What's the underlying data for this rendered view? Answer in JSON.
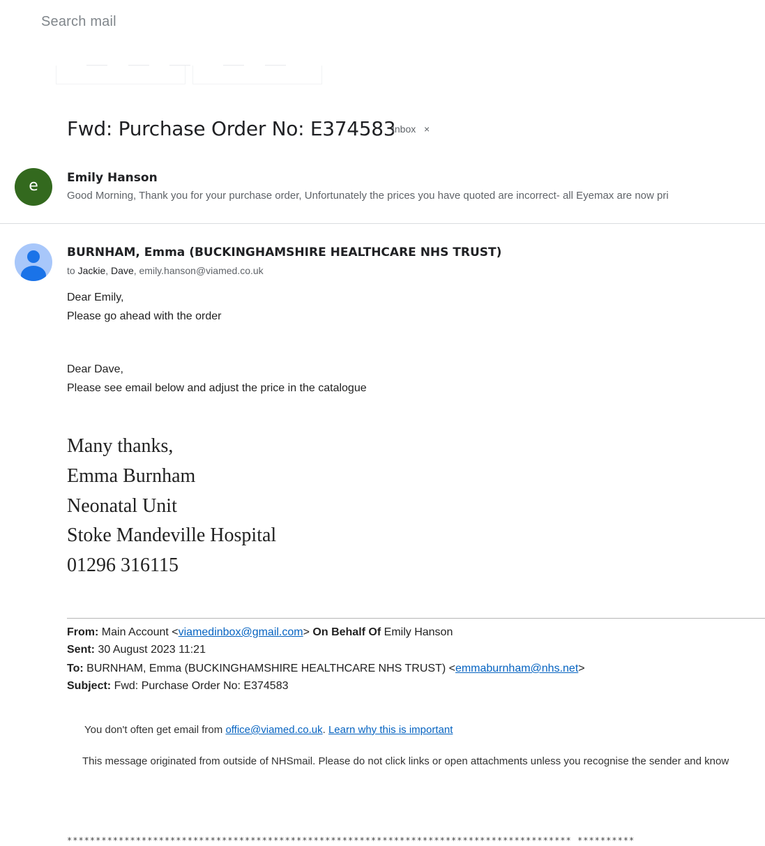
{
  "search": {
    "placeholder": "Search mail"
  },
  "thread": {
    "subject": "Fwd: Purchase Order No: E374583",
    "label": "Inbox",
    "label_remove": "×"
  },
  "messages": [
    {
      "avatar_letter": "e",
      "sender": "Emily Hanson",
      "snippet": "Good Morning, Thank you for your purchase order, Unfortunately the prices you have quoted are incorrect- all Eyemax are now pri"
    },
    {
      "sender": "BURNHAM, Emma (BUCKINGHAMSHIRE HEALTHCARE NHS TRUST)",
      "to_prefix": "to",
      "recipients": [
        "Jackie",
        "Dave",
        "emily.hanson@viamed.co.uk"
      ],
      "body": [
        "Dear Emily,",
        "Please go ahead with the order",
        "Dear Dave,",
        "Please see email below and adjust the price in the catalogue"
      ],
      "signature": [
        "Many thanks,",
        "Emma Burnham",
        "Neonatal Unit",
        "Stoke Mandeville Hospital",
        "01296 316115"
      ],
      "forwarded": {
        "from_label": "From:",
        "from_name": "Main Account <",
        "from_email": "viamedinbox@gmail.com",
        "from_close": ">",
        "on_behalf_label": "On Behalf Of",
        "on_behalf_name": "Emily Hanson",
        "sent_label": "Sent:",
        "sent_value": "30 August 2023 11:21",
        "to_label": "To:",
        "to_name": "BURNHAM, Emma (BUCKINGHAMSHIRE HEALTHCARE NHS TRUST) <",
        "to_email": "emmaburnham@nhs.net",
        "to_close": ">",
        "subject_label": "Subject:",
        "subject_value": "Fwd: Purchase Order No: E374583"
      },
      "notice_prefix": "You don't often get email from ",
      "notice_email": "office@viamed.co.uk",
      "notice_sep": ". ",
      "notice_link": "Learn why this is important",
      "warning": "This message originated from outside of NHSmail. Please do not click links or open attachments unless you recognise the sender and know",
      "stars": "****************************************************************************************  **********"
    }
  ]
}
